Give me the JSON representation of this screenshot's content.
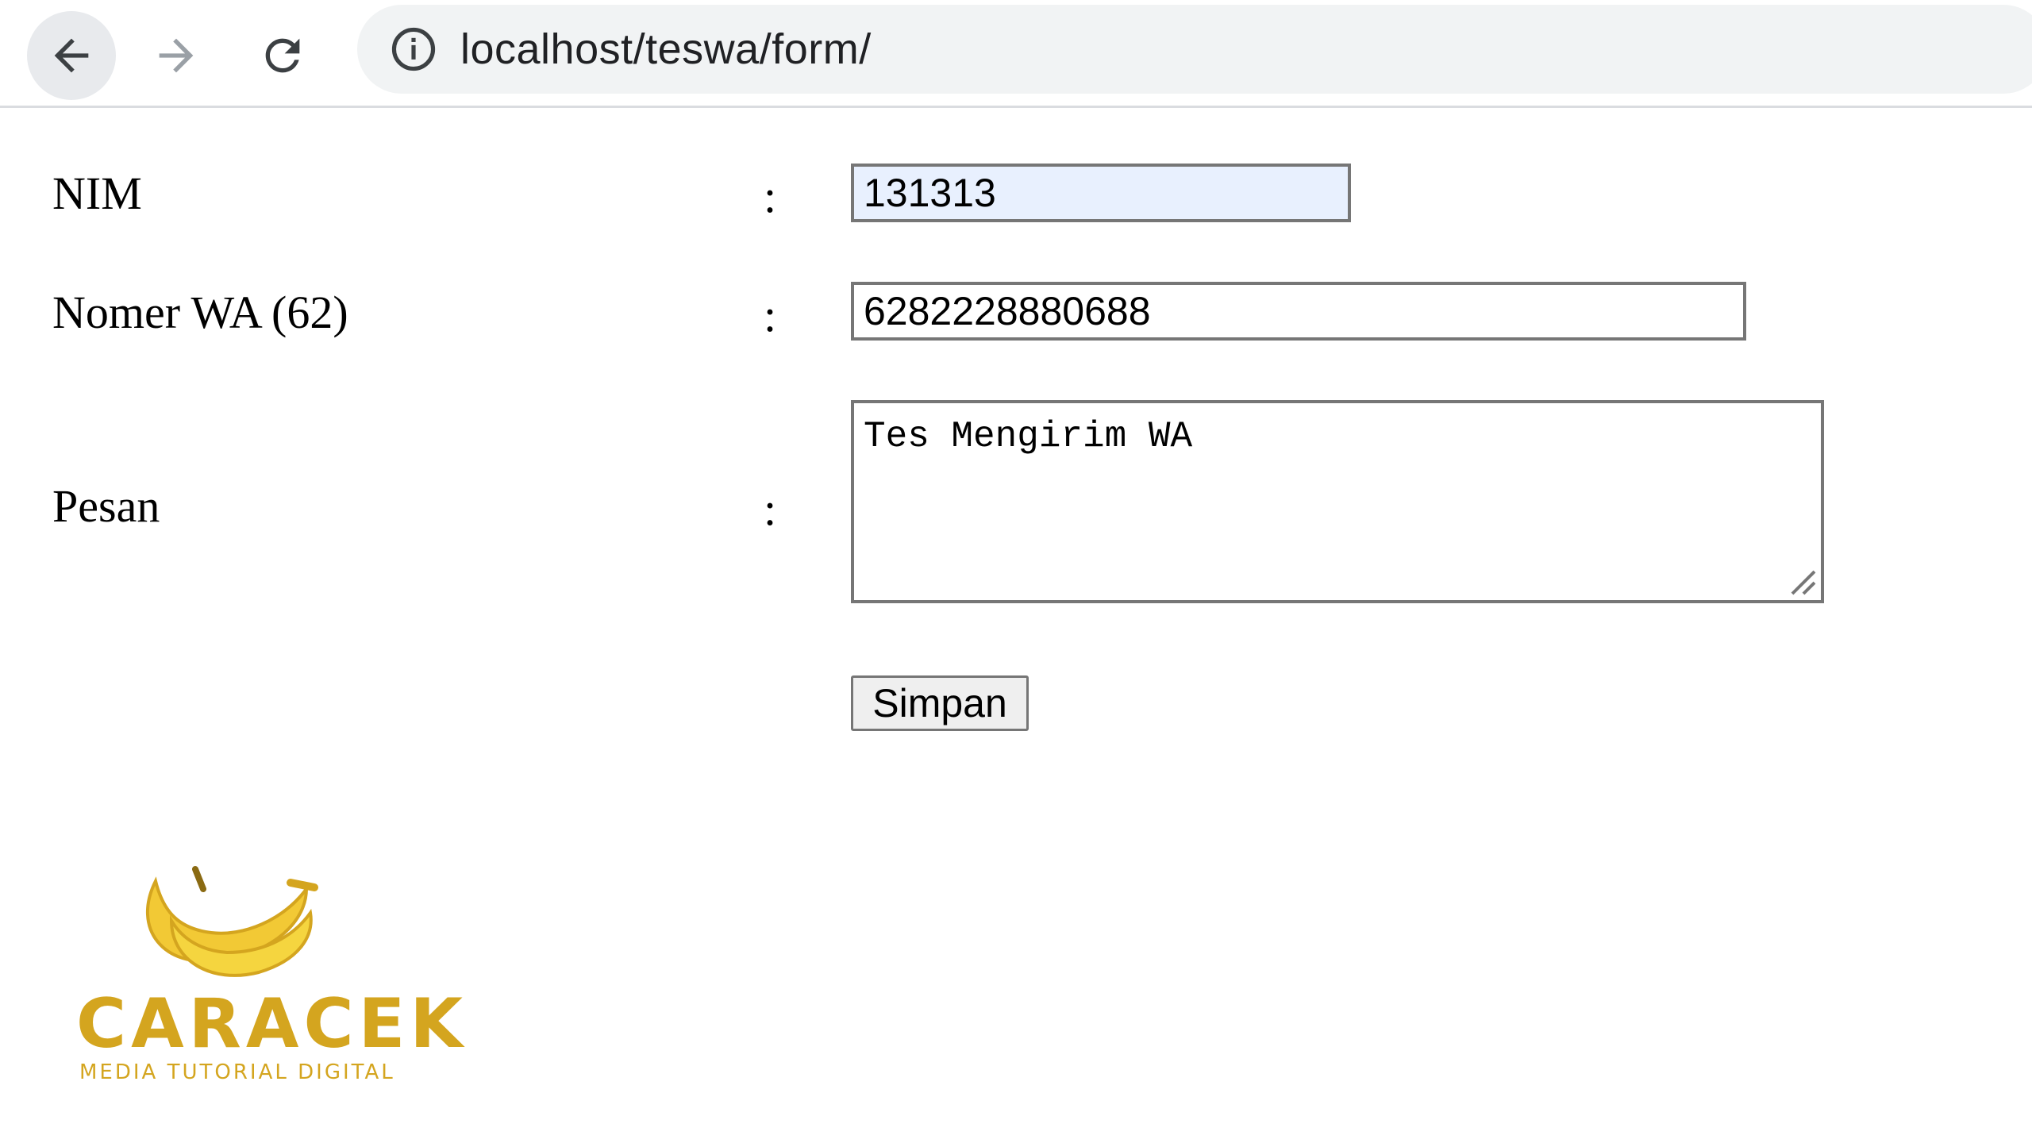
{
  "browser": {
    "url": "localhost/teswa/form/"
  },
  "form": {
    "nim_label": "NIM",
    "nim_value": "131313",
    "wa_label": "Nomer WA (62)",
    "wa_value": "6282228880688",
    "pesan_label": "Pesan",
    "pesan_value": "Tes Mengirim WA",
    "colon": ":",
    "submit_label": "Simpan"
  },
  "watermark": {
    "brand": "CARACEK",
    "tagline": "MEDIA TUTORIAL DIGITAL"
  },
  "icons": {
    "back": "back-arrow-icon",
    "forward": "forward-arrow-icon",
    "reload": "reload-icon",
    "site_info": "info-icon"
  }
}
